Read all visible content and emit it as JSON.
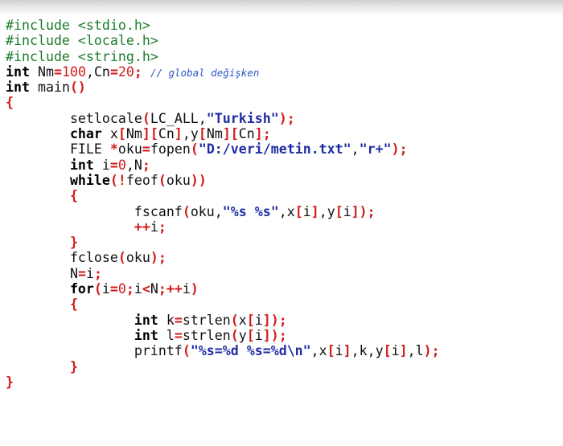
{
  "code_lines": [
    {
      "indent": 0,
      "tokens": [
        {
          "t": "pre",
          "v": "#include <stdio.h>"
        }
      ]
    },
    {
      "indent": 0,
      "tokens": [
        {
          "t": "pre",
          "v": "#include <locale.h>"
        }
      ]
    },
    {
      "indent": 0,
      "tokens": [
        {
          "t": "pre",
          "v": "#include <string.h>"
        }
      ]
    },
    {
      "indent": 0,
      "tokens": [
        {
          "t": "kw",
          "v": "int"
        },
        {
          "t": "id",
          "v": " Nm"
        },
        {
          "t": "pun",
          "v": "="
        },
        {
          "t": "num",
          "v": "100"
        },
        {
          "t": "id",
          "v": ",Cn"
        },
        {
          "t": "pun",
          "v": "="
        },
        {
          "t": "num",
          "v": "20"
        },
        {
          "t": "pun",
          "v": ";"
        },
        {
          "t": "id",
          "v": " "
        },
        {
          "t": "cmt",
          "v": "// global değişken"
        }
      ]
    },
    {
      "indent": 0,
      "tokens": [
        {
          "t": "kw",
          "v": "int"
        },
        {
          "t": "id",
          "v": " main"
        },
        {
          "t": "pun",
          "v": "()"
        }
      ]
    },
    {
      "indent": 0,
      "tokens": [
        {
          "t": "pun",
          "v": "{"
        }
      ]
    },
    {
      "indent": 8,
      "tokens": [
        {
          "t": "id",
          "v": "setlocale"
        },
        {
          "t": "pun",
          "v": "("
        },
        {
          "t": "id",
          "v": "LC_ALL,"
        },
        {
          "t": "str",
          "v": "\"Turkish\""
        },
        {
          "t": "pun",
          "v": ");"
        }
      ]
    },
    {
      "indent": 8,
      "tokens": [
        {
          "t": "kw",
          "v": "char"
        },
        {
          "t": "id",
          "v": " x"
        },
        {
          "t": "pun",
          "v": "["
        },
        {
          "t": "id",
          "v": "Nm"
        },
        {
          "t": "pun",
          "v": "]["
        },
        {
          "t": "id",
          "v": "Cn"
        },
        {
          "t": "pun",
          "v": "]"
        },
        {
          "t": "id",
          "v": ",y"
        },
        {
          "t": "pun",
          "v": "["
        },
        {
          "t": "id",
          "v": "Nm"
        },
        {
          "t": "pun",
          "v": "]["
        },
        {
          "t": "id",
          "v": "Cn"
        },
        {
          "t": "pun",
          "v": "];"
        }
      ]
    },
    {
      "indent": 8,
      "tokens": [
        {
          "t": "id",
          "v": "FILE "
        },
        {
          "t": "pun",
          "v": "*"
        },
        {
          "t": "id",
          "v": "oku"
        },
        {
          "t": "pun",
          "v": "="
        },
        {
          "t": "id",
          "v": "fopen"
        },
        {
          "t": "pun",
          "v": "("
        },
        {
          "t": "str",
          "v": "\"D:/veri/metin.txt\""
        },
        {
          "t": "id",
          "v": ","
        },
        {
          "t": "str",
          "v": "\"r+\""
        },
        {
          "t": "pun",
          "v": ");"
        }
      ]
    },
    {
      "indent": 8,
      "tokens": [
        {
          "t": "kw",
          "v": "int"
        },
        {
          "t": "id",
          "v": " i"
        },
        {
          "t": "pun",
          "v": "="
        },
        {
          "t": "num",
          "v": "0"
        },
        {
          "t": "id",
          "v": ",N"
        },
        {
          "t": "pun",
          "v": ";"
        }
      ]
    },
    {
      "indent": 8,
      "tokens": [
        {
          "t": "kw",
          "v": "while"
        },
        {
          "t": "pun",
          "v": "(!"
        },
        {
          "t": "id",
          "v": "feof"
        },
        {
          "t": "pun",
          "v": "("
        },
        {
          "t": "id",
          "v": "oku"
        },
        {
          "t": "pun",
          "v": "))"
        }
      ]
    },
    {
      "indent": 8,
      "tokens": [
        {
          "t": "pun",
          "v": "{"
        }
      ]
    },
    {
      "indent": 16,
      "tokens": [
        {
          "t": "id",
          "v": "fscanf"
        },
        {
          "t": "pun",
          "v": "("
        },
        {
          "t": "id",
          "v": "oku,"
        },
        {
          "t": "str",
          "v": "\"%s %s\""
        },
        {
          "t": "id",
          "v": ",x"
        },
        {
          "t": "pun",
          "v": "["
        },
        {
          "t": "id",
          "v": "i"
        },
        {
          "t": "pun",
          "v": "]"
        },
        {
          "t": "id",
          "v": ",y"
        },
        {
          "t": "pun",
          "v": "["
        },
        {
          "t": "id",
          "v": "i"
        },
        {
          "t": "pun",
          "v": "]);"
        }
      ]
    },
    {
      "indent": 16,
      "tokens": [
        {
          "t": "pun",
          "v": "++"
        },
        {
          "t": "id",
          "v": "i"
        },
        {
          "t": "pun",
          "v": ";"
        }
      ]
    },
    {
      "indent": 8,
      "tokens": [
        {
          "t": "pun",
          "v": "}"
        }
      ]
    },
    {
      "indent": 8,
      "tokens": [
        {
          "t": "id",
          "v": "fclose"
        },
        {
          "t": "pun",
          "v": "("
        },
        {
          "t": "id",
          "v": "oku"
        },
        {
          "t": "pun",
          "v": ");"
        }
      ]
    },
    {
      "indent": 8,
      "tokens": [
        {
          "t": "id",
          "v": "N"
        },
        {
          "t": "pun",
          "v": "="
        },
        {
          "t": "id",
          "v": "i"
        },
        {
          "t": "pun",
          "v": ";"
        }
      ]
    },
    {
      "indent": 8,
      "tokens": [
        {
          "t": "kw",
          "v": "for"
        },
        {
          "t": "pun",
          "v": "("
        },
        {
          "t": "id",
          "v": "i"
        },
        {
          "t": "pun",
          "v": "="
        },
        {
          "t": "num",
          "v": "0"
        },
        {
          "t": "pun",
          "v": ";"
        },
        {
          "t": "id",
          "v": "i"
        },
        {
          "t": "pun",
          "v": "<"
        },
        {
          "t": "id",
          "v": "N"
        },
        {
          "t": "pun",
          "v": ";++"
        },
        {
          "t": "id",
          "v": "i"
        },
        {
          "t": "pun",
          "v": ")"
        }
      ]
    },
    {
      "indent": 8,
      "tokens": [
        {
          "t": "pun",
          "v": "{"
        }
      ]
    },
    {
      "indent": 16,
      "tokens": [
        {
          "t": "kw",
          "v": "int"
        },
        {
          "t": "id",
          "v": " k"
        },
        {
          "t": "pun",
          "v": "="
        },
        {
          "t": "id",
          "v": "strlen"
        },
        {
          "t": "pun",
          "v": "("
        },
        {
          "t": "id",
          "v": "x"
        },
        {
          "t": "pun",
          "v": "["
        },
        {
          "t": "id",
          "v": "i"
        },
        {
          "t": "pun",
          "v": "]);"
        }
      ]
    },
    {
      "indent": 16,
      "tokens": [
        {
          "t": "kw",
          "v": "int"
        },
        {
          "t": "id",
          "v": " l"
        },
        {
          "t": "pun",
          "v": "="
        },
        {
          "t": "id",
          "v": "strlen"
        },
        {
          "t": "pun",
          "v": "("
        },
        {
          "t": "id",
          "v": "y"
        },
        {
          "t": "pun",
          "v": "["
        },
        {
          "t": "id",
          "v": "i"
        },
        {
          "t": "pun",
          "v": "]);"
        }
      ]
    },
    {
      "indent": 16,
      "tokens": [
        {
          "t": "id",
          "v": "printf"
        },
        {
          "t": "pun",
          "v": "("
        },
        {
          "t": "str",
          "v": "\"%s=%d %s=%d\\n\""
        },
        {
          "t": "id",
          "v": ",x"
        },
        {
          "t": "pun",
          "v": "["
        },
        {
          "t": "id",
          "v": "i"
        },
        {
          "t": "pun",
          "v": "]"
        },
        {
          "t": "id",
          "v": ",k,y"
        },
        {
          "t": "pun",
          "v": "["
        },
        {
          "t": "id",
          "v": "i"
        },
        {
          "t": "pun",
          "v": "]"
        },
        {
          "t": "id",
          "v": ",l"
        },
        {
          "t": "pun",
          "v": ");"
        }
      ]
    },
    {
      "indent": 8,
      "tokens": [
        {
          "t": "pun",
          "v": "}"
        }
      ]
    },
    {
      "indent": 0,
      "tokens": [
        {
          "t": "pun",
          "v": "}"
        }
      ]
    }
  ]
}
